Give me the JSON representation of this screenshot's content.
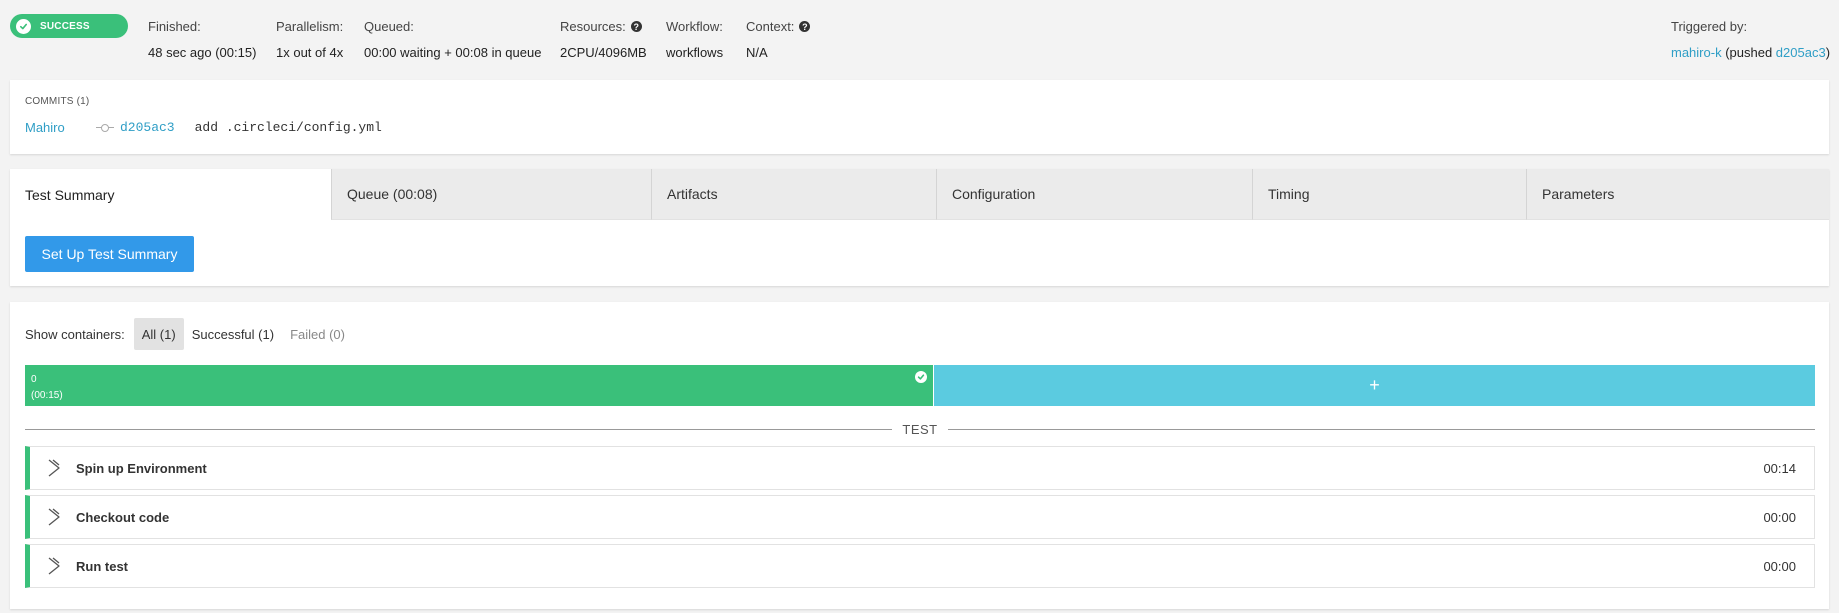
{
  "status": {
    "label": "SUCCESS",
    "color": "#3ac07a"
  },
  "meta": {
    "finished": {
      "label": "Finished:",
      "value": "48 sec ago (00:15)"
    },
    "parallelism": {
      "label": "Parallelism:",
      "value": "1x out of 4x"
    },
    "queued": {
      "label": "Queued:",
      "value": "00:00 waiting + 00:08 in queue"
    },
    "resources": {
      "label": "Resources:",
      "value": "2CPU/4096MB"
    },
    "workflow": {
      "label": "Workflow:",
      "value": "workflows"
    },
    "context": {
      "label": "Context:",
      "value": "N/A"
    },
    "triggered": {
      "label": "Triggered by:",
      "user": "mahiro-k",
      "pushed_prefix": "(pushed ",
      "sha": "d205ac3",
      "suffix": ")"
    }
  },
  "commits": {
    "title": "COMMITS (1)",
    "items": [
      {
        "author": "Mahiro",
        "sha": "d205ac3",
        "message": "add .circleci/config.yml"
      }
    ]
  },
  "tabs": [
    {
      "label": "Test Summary",
      "active": true
    },
    {
      "label": "Queue (00:08)",
      "active": false
    },
    {
      "label": "Artifacts",
      "active": false
    },
    {
      "label": "Configuration",
      "active": false
    },
    {
      "label": "Timing",
      "active": false
    },
    {
      "label": "Parameters",
      "active": false
    }
  ],
  "setup_button": "Set Up Test Summary",
  "containers": {
    "label": "Show containers:",
    "filters": [
      {
        "label": "All (1)",
        "state": "active"
      },
      {
        "label": "Successful (1)",
        "state": "normal"
      },
      {
        "label": "Failed (0)",
        "state": "disabled"
      }
    ],
    "bar": {
      "index": "0",
      "duration": "(00:15)",
      "add_label": "+"
    }
  },
  "section": "TEST",
  "steps": [
    {
      "name": "Spin up Environment",
      "duration": "00:14"
    },
    {
      "name": "Checkout code",
      "duration": "00:00"
    },
    {
      "name": "Run test",
      "duration": "00:00"
    }
  ],
  "colors": {
    "success": "#3ac07a",
    "link": "#2f9ec6",
    "primary": "#3299e9",
    "container_add": "#5bcbe0"
  },
  "icons": {
    "status": "check-circle-icon",
    "help": "question-circle-icon",
    "commit": "commit-icon",
    "step": "chevron-right-icon"
  }
}
